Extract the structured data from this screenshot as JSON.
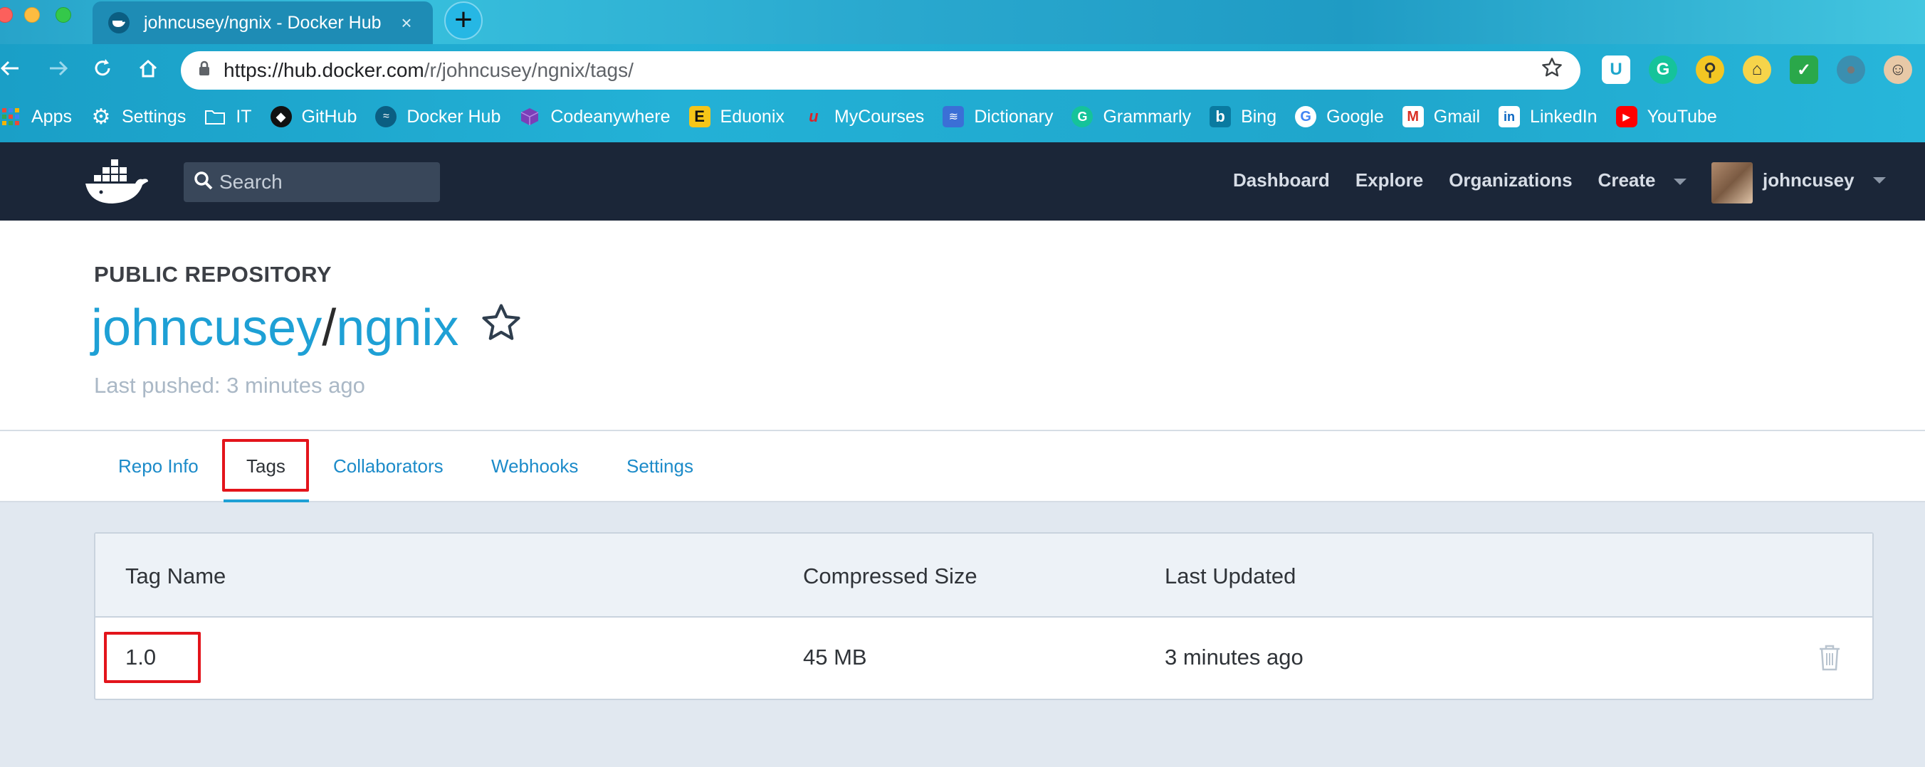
{
  "browser": {
    "tab_title": "johncusey/ngnix - Docker Hub",
    "tab_close": "×",
    "new_tab": "+",
    "url_host": "https://hub.docker.com",
    "url_path": "/r/johncusey/ngnix/tags/",
    "bookmarks": [
      {
        "label": "Apps",
        "icon": "apps-grid-icon",
        "color": "#e84a3a"
      },
      {
        "label": "Settings",
        "icon": "gear-icon",
        "color": "#ffffff"
      },
      {
        "label": "IT",
        "icon": "folder-icon",
        "color": "#ffffff"
      },
      {
        "label": "GitHub",
        "icon": "github-icon",
        "color": "#111111"
      },
      {
        "label": "Docker Hub",
        "icon": "docker-icon",
        "color": "#0b5e82"
      },
      {
        "label": "Codeanywhere",
        "icon": "cube-icon",
        "color": "#7b3fb8"
      },
      {
        "label": "Eduonix",
        "icon": "eduonix-icon",
        "color": "#f5c518"
      },
      {
        "label": "MyCourses",
        "icon": "mycourses-icon",
        "color": "#d8242a"
      },
      {
        "label": "Dictionary",
        "icon": "dictionary-icon",
        "color": "#3b6fd6"
      },
      {
        "label": "Grammarly",
        "icon": "grammarly-icon",
        "color": "#15c39a"
      },
      {
        "label": "Bing",
        "icon": "bing-icon",
        "color": "#0a7aa0"
      },
      {
        "label": "Google",
        "icon": "google-icon",
        "color": "#ffffff"
      },
      {
        "label": "Gmail",
        "icon": "gmail-icon",
        "color": "#ffffff"
      },
      {
        "label": "LinkedIn",
        "icon": "linkedin-icon",
        "color": "#0a66c2"
      },
      {
        "label": "YouTube",
        "icon": "youtube-icon",
        "color": "#ff0000"
      }
    ]
  },
  "hub_nav": {
    "search_label": "Search",
    "links": [
      "Dashboard",
      "Explore",
      "Organizations",
      "Create"
    ],
    "username": "johncusey"
  },
  "repo": {
    "kind": "PUBLIC REPOSITORY",
    "namespace": "johncusey",
    "separator": "/",
    "name": "ngnix",
    "last_pushed": "Last pushed: 3 minutes ago"
  },
  "tabs": [
    "Repo Info",
    "Tags",
    "Collaborators",
    "Webhooks",
    "Settings"
  ],
  "tags_table": {
    "headers": {
      "name": "Tag Name",
      "size": "Compressed Size",
      "updated": "Last Updated"
    },
    "rows": [
      {
        "name": "1.0",
        "size": "45 MB",
        "updated": "3 minutes ago"
      }
    ]
  },
  "colors": {
    "accent": "#1ea0d5",
    "nav_bg": "#1b2638",
    "highlight": "#e3141b"
  }
}
